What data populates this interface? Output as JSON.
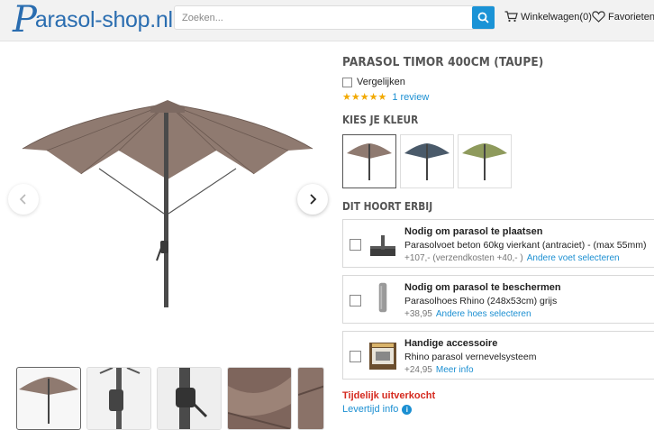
{
  "header": {
    "logo_p": "P",
    "logo_text": "arasol-shop.nl",
    "search_placeholder": "Zoeken...",
    "cart_label": "Winkelwagen(0)",
    "favorites_label": "Favorieten"
  },
  "product": {
    "title": "PARASOL TIMOR 400CM (TAUPE)",
    "compare_label": "Vergelijken",
    "stars": "★★★★★",
    "review_label": "1 review",
    "color_section": "KIES JE KLEUR",
    "colors": [
      "taupe",
      "antraciet",
      "groen"
    ],
    "accessories_section": "DIT HOORT ERBIJ",
    "sold_out": "Tijdelijk uitverkocht",
    "delivery_info": "Levertijd info"
  },
  "accessories": [
    {
      "heading": "Nodig om parasol te plaatsen",
      "desc": "Parasolvoet beton 60kg vierkant (antraciet) - (max 55mm)",
      "price": "+107,-  (verzendkosten +40,- )",
      "link": "Andere voet selecteren"
    },
    {
      "heading": "Nodig om parasol te beschermen",
      "desc": "Parasolhoes Rhino (248x53cm) grijs",
      "price": "+38,95",
      "link": "Andere hoes selecteren"
    },
    {
      "heading": "Handige accessoire",
      "desc": "Rhino parasol vernevelsysteem",
      "price": "+24,95",
      "link": "Meer info"
    }
  ],
  "colors": {
    "accent": "#1b93d6",
    "link": "#1b8fd2",
    "sold_out": "#d52a1f",
    "taupe": "#8f7a70",
    "antraciet": "#4a5a6a",
    "groen": "#8e9a5c"
  }
}
